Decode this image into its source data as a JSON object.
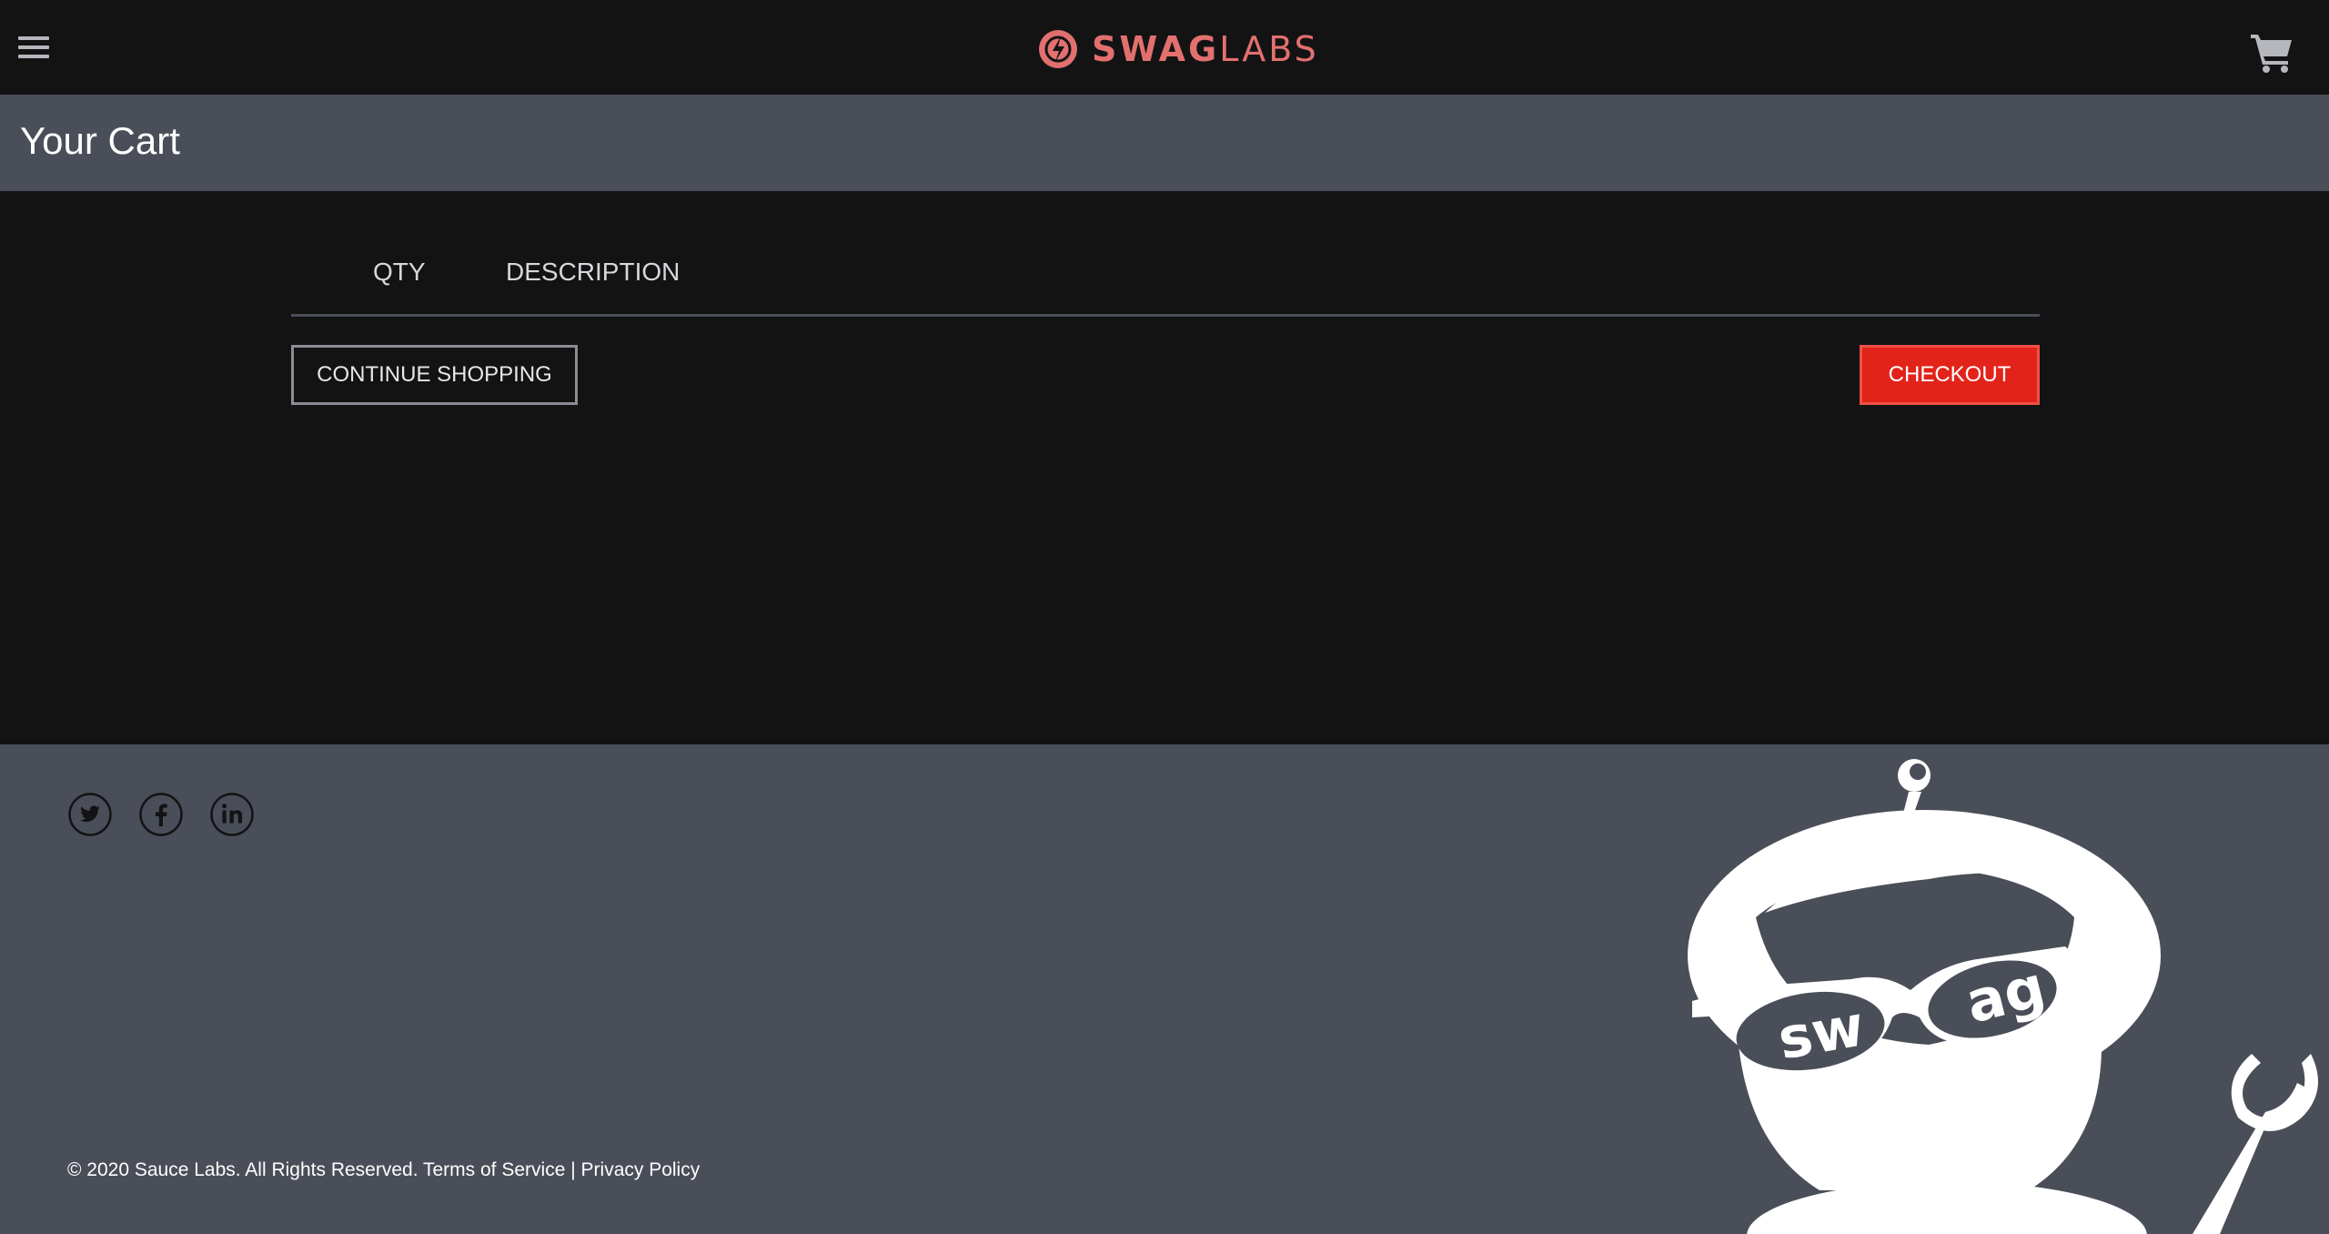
{
  "header": {
    "logo_bold": "SWAG",
    "logo_light": "LABS",
    "menu_icon": "hamburger-menu-icon",
    "cart_icon": "shopping-cart-icon"
  },
  "subheader": {
    "title": "Your Cart"
  },
  "cart": {
    "columns": [
      "QTY",
      "DESCRIPTION"
    ],
    "items": []
  },
  "actions": {
    "continue_label": "CONTINUE SHOPPING",
    "checkout_label": "CHECKOUT"
  },
  "footer": {
    "social": [
      "twitter-icon",
      "facebook-icon",
      "linkedin-icon"
    ],
    "copyright": "© 2020 Sauce Labs. All Rights Reserved.",
    "terms_label": "Terms of Service",
    "separator": "|",
    "privacy_label": "Privacy Policy",
    "mascot_text_left": "sw",
    "mascot_text_right": "ag"
  },
  "colors": {
    "accent": "#e2231a",
    "logo": "#e2706f",
    "background": "#131314",
    "bar": "#4a4e58"
  }
}
